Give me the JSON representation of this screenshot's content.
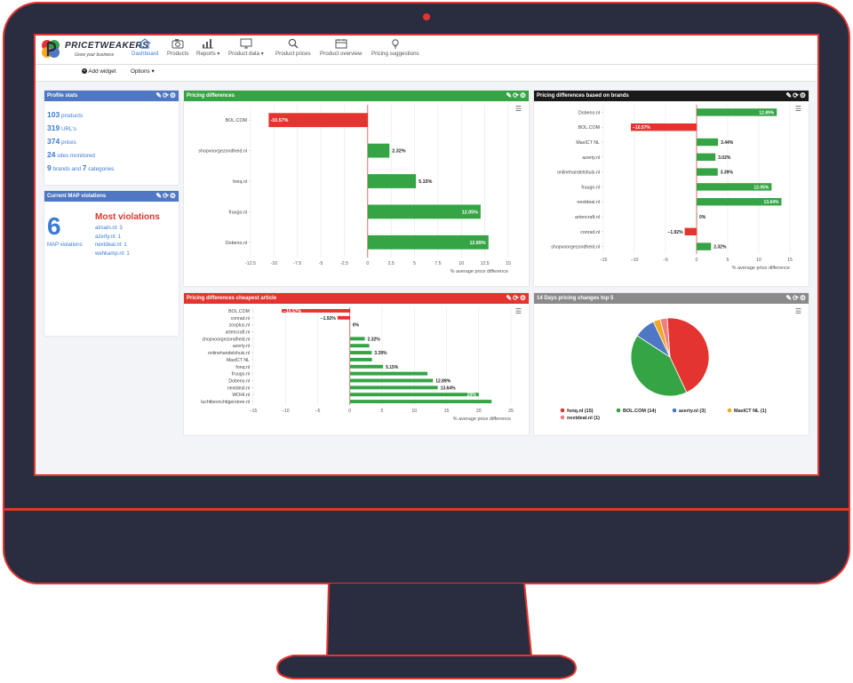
{
  "brand": {
    "name": "PRICETWEAKERS",
    "tagline": "Grow your business"
  },
  "nav": [
    {
      "label": "Dashboard",
      "icon": "home-icon"
    },
    {
      "label": "Products",
      "icon": "camera-icon"
    },
    {
      "label": "Reports ▾",
      "icon": "chart-icon"
    },
    {
      "label": "Product data ▾",
      "icon": "monitor-icon"
    },
    {
      "label": "Product prices",
      "icon": "search-icon"
    },
    {
      "label": "Product overview",
      "icon": "calendar-icon"
    },
    {
      "label": "Pricing suggestions",
      "icon": "lightbulb-icon"
    }
  ],
  "toolbar": {
    "add_widget": "Add widget",
    "options": "Options ▾"
  },
  "profile": {
    "title": "Profile stats",
    "products_n": "103",
    "products_l": "products",
    "urls_n": "319",
    "urls_l": "URL's",
    "prices_n": "374",
    "prices_l": "prices",
    "sites_n": "24",
    "sites_l": "sites monitored",
    "brands_n": "9",
    "brands_l": "brands and",
    "cats_n": "7",
    "cats_l": "categories"
  },
  "map": {
    "title": "Current MAP violations",
    "count": "6",
    "count_label": "MAP violations",
    "most": "Most violations",
    "items": [
      "airsain.nl: 3",
      "azerty.nl: 1",
      "nextdeal.nl: 1",
      "wehkamp.nl: 1"
    ]
  },
  "widget_titles": {
    "w1": "Pricing differences",
    "w2": "Pricing differences based on brands",
    "w3": "Pricing differences cheapest article",
    "w4": "14 Days pricing changes top 5"
  },
  "colors": {
    "red": "#e3342f",
    "green": "#34a444",
    "blue": "#4f77c4",
    "orange": "#f5a623",
    "pink": "#f08080"
  },
  "chart_data": [
    {
      "type": "bar",
      "orientation": "horizontal",
      "title": "Pricing differences",
      "categories": [
        "BOL.COM",
        "shopvoorgezondheid.nl",
        "fonq.nl",
        "fruugo.nl",
        "Dobeno.nl"
      ],
      "values": [
        -10.57,
        2.32,
        5.15,
        12.05,
        12.89
      ],
      "labels": [
        "-10.57%",
        "2.32%",
        "5.15%",
        "12.05%",
        "12.89%"
      ],
      "xlabel": "% average price difference",
      "xlim": [
        -12.5,
        15
      ],
      "xticks": [
        "-12.5",
        "-10",
        "-7.5",
        "-5",
        "-2.5",
        "0",
        "2.5",
        "5",
        "7.5",
        "10",
        "12.5",
        "15"
      ]
    },
    {
      "type": "bar",
      "orientation": "horizontal",
      "title": "Pricing differences based on brands",
      "categories": [
        "Dobeno.nl",
        "BOL.COM",
        "MaxICT NL",
        "azerty.nl",
        "onlinehandelshuis.nl",
        "fruugo.nl",
        "nextdeal.nl",
        "artencraft.nl",
        "conrad.nl",
        "shopvoorgezondheid.nl"
      ],
      "values": [
        12.89,
        -10.57,
        3.44,
        3.02,
        3.39,
        12.05,
        13.64,
        0,
        -1.92,
        2.32
      ],
      "labels": [
        "12.89%",
        "−10.57%",
        "3.44%",
        "3.02%",
        "3.39%",
        "12.05%",
        "13.64%",
        "0%",
        "−1.92%",
        "2.32%"
      ],
      "xlabel": "% average price difference",
      "xlim": [
        -15,
        15
      ],
      "xticks": [
        "−15",
        "−10",
        "−5",
        "0",
        "5",
        "10",
        "15"
      ]
    },
    {
      "type": "bar",
      "orientation": "horizontal",
      "title": "Pricing differences cheapest article",
      "categories": [
        "BOL.COM",
        "conrad.nl",
        "zooplus.nl",
        "artencraft.nl",
        "shopvoorgezondheid.nl",
        "azerty.nl",
        "onlinehandelshuis.nl",
        "MaxICT NL",
        "fonq.nl",
        "fruugo.nl",
        "Dobeno.nl",
        "nextdeal.nl",
        "WOHI.nl",
        "luchtbevochtigerstore.nl"
      ],
      "values": [
        -10.57,
        -1.92,
        0,
        0,
        2.32,
        3.02,
        3.39,
        3.44,
        5.15,
        12.05,
        12.89,
        13.64,
        20,
        22
      ],
      "labels": [
        "−10.57%",
        "−1.92%",
        "0%",
        "",
        "2.32%",
        "",
        "3.39%",
        "",
        "5.15%",
        "",
        "12.89%",
        "13.64%",
        "20%",
        ""
      ],
      "xlabel": "% average price difference",
      "xlim": [
        -15,
        25
      ],
      "xticks": [
        "−15",
        "−10",
        "−5",
        "0",
        "5",
        "10",
        "15",
        "20",
        "25"
      ]
    },
    {
      "type": "pie",
      "title": "14 Days pricing changes top 5",
      "categories": [
        "fonq.nl (15)",
        "BOL.COM (14)",
        "azerty.nl (3)",
        "MaxICT NL (1)",
        "nextdeal.nl (1)"
      ],
      "values": [
        15,
        14,
        3,
        1,
        1
      ],
      "colors": [
        "#e3342f",
        "#34a444",
        "#4f77c4",
        "#f5a623",
        "#f08080"
      ]
    }
  ]
}
